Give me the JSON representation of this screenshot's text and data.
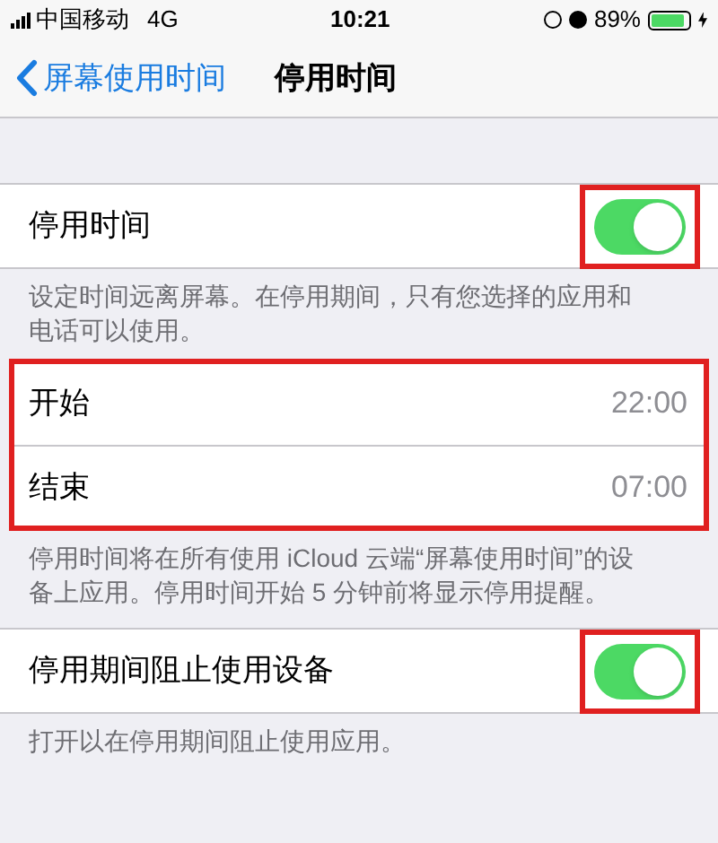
{
  "status_bar": {
    "carrier": "中国移动",
    "network": "4G",
    "time": "10:21",
    "battery": "89%"
  },
  "nav": {
    "back": "屏幕使用时间",
    "title": "停用时间"
  },
  "sections": [
    {
      "kind": "toggle",
      "label": "停用时间",
      "on": true,
      "highlighted": true,
      "footer": "设定时间远离屏幕。在停用期间，只有您选择的应用和电话可以使用。"
    },
    {
      "kind": "times",
      "highlighted": true,
      "rows": [
        {
          "label": "开始",
          "value": "22:00"
        },
        {
          "label": "结束",
          "value": "07:00"
        }
      ],
      "footer": "停用时间将在所有使用 iCloud 云端“屏幕使用时间”的设备上应用。停用时间开始 5 分钟前将显示停用提醒。"
    },
    {
      "kind": "toggle",
      "label": "停用期间阻止使用设备",
      "on": true,
      "highlighted": true,
      "footer": "打开以在停用期间阻止使用应用。"
    }
  ]
}
